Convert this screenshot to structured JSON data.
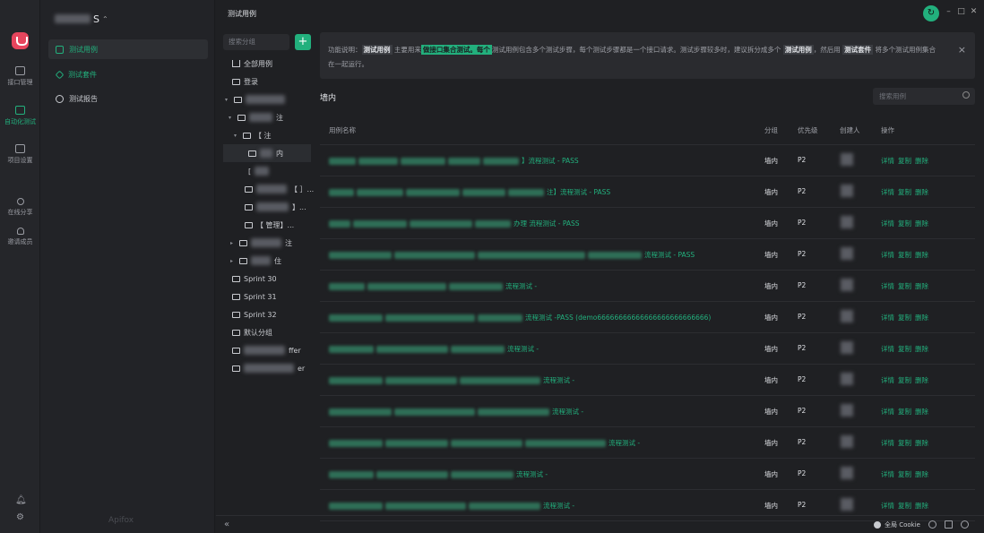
{
  "app": {
    "title": "测试用例"
  },
  "rail": {
    "items": [
      {
        "label": "接口管理"
      },
      {
        "label": "自动化测试"
      },
      {
        "label": "项目设置"
      },
      {
        "label": "在线分享"
      },
      {
        "label": "邀请成员"
      }
    ],
    "accent": "#22b07d"
  },
  "project": {
    "name_suffix": "S"
  },
  "nav": {
    "items": [
      {
        "label": "测试用例"
      },
      {
        "label": "测试套件"
      },
      {
        "label": "测试报告"
      }
    ],
    "brand": "Apifox"
  },
  "tree": {
    "search_placeholder": "搜索分组",
    "add_label": "+",
    "rows": [
      {
        "label": "全部用例"
      },
      {
        "label": "登录"
      },
      {
        "label": ""
      },
      {
        "label": "注"
      },
      {
        "label": "【 注"
      },
      {
        "label": "内"
      },
      {
        "label": "["
      },
      {
        "label": "【 ］..."
      },
      {
        "label": "】..."
      },
      {
        "label": "【 管理】..."
      },
      {
        "label": "注"
      },
      {
        "label": "住"
      },
      {
        "label": "Sprint 30"
      },
      {
        "label": "Sprint 31"
      },
      {
        "label": "Sprint 32"
      },
      {
        "label": "默认分组"
      },
      {
        "label": "ffer"
      },
      {
        "label": "er"
      }
    ]
  },
  "notice": {
    "prefix": "功能说明：",
    "b1": "测试用例",
    "t1": " 主要用来",
    "hl": "做接口集合测试。每个",
    "t2": "测试用例包含多个测试步骤，每个测试步骤都是一个接口请求。测试步骤较多时，建议拆分成多个 ",
    "b2": "测试用例",
    "t3": "，然后用 ",
    "b3": "测试套件",
    "t4": " 将多个测试用例集合在一起运行。",
    "close": "×"
  },
  "group_title": "墙内",
  "case_search_placeholder": "搜索用例",
  "table": {
    "headers": {
      "name": "用例名称",
      "group": "分组",
      "priority": "优先级",
      "creator": "创建人",
      "actions": "操作"
    },
    "rows": [
      {
        "name_tail": "】流程测试 - PASS",
        "group": "墙内",
        "priority": "P2"
      },
      {
        "name_tail": "注】流程测试 - PASS",
        "group": "墙内",
        "priority": "P2"
      },
      {
        "name_tail": "办理     流程测试 - PASS",
        "group": "墙内",
        "priority": "P2"
      },
      {
        "name_tail": "流程测试 - PASS",
        "group": "墙内",
        "priority": "P2"
      },
      {
        "name_tail": "流程测试 -",
        "group": "墙内",
        "priority": "P2"
      },
      {
        "name_tail": "流程测试 -PASS   (demo66666666666666666666666666)",
        "group": "墙内",
        "priority": "P2"
      },
      {
        "name_tail": "流程测试 -",
        "group": "墙内",
        "priority": "P2"
      },
      {
        "name_tail": "流程测试 -",
        "group": "墙内",
        "priority": "P2"
      },
      {
        "name_tail": "流程测试 -",
        "group": "墙内",
        "priority": "P2"
      },
      {
        "name_tail": "流程测试 -",
        "group": "墙内",
        "priority": "P2"
      },
      {
        "name_tail": "流程测试 -",
        "group": "墙内",
        "priority": "P2"
      },
      {
        "name_tail": "流程测试 -",
        "group": "墙内",
        "priority": "P2"
      }
    ],
    "actions": {
      "detail": "详情",
      "copy": "复制",
      "delete": "删除"
    }
  },
  "bottombar": {
    "collapse": "«",
    "cookie_label": "全局 Cookie"
  }
}
